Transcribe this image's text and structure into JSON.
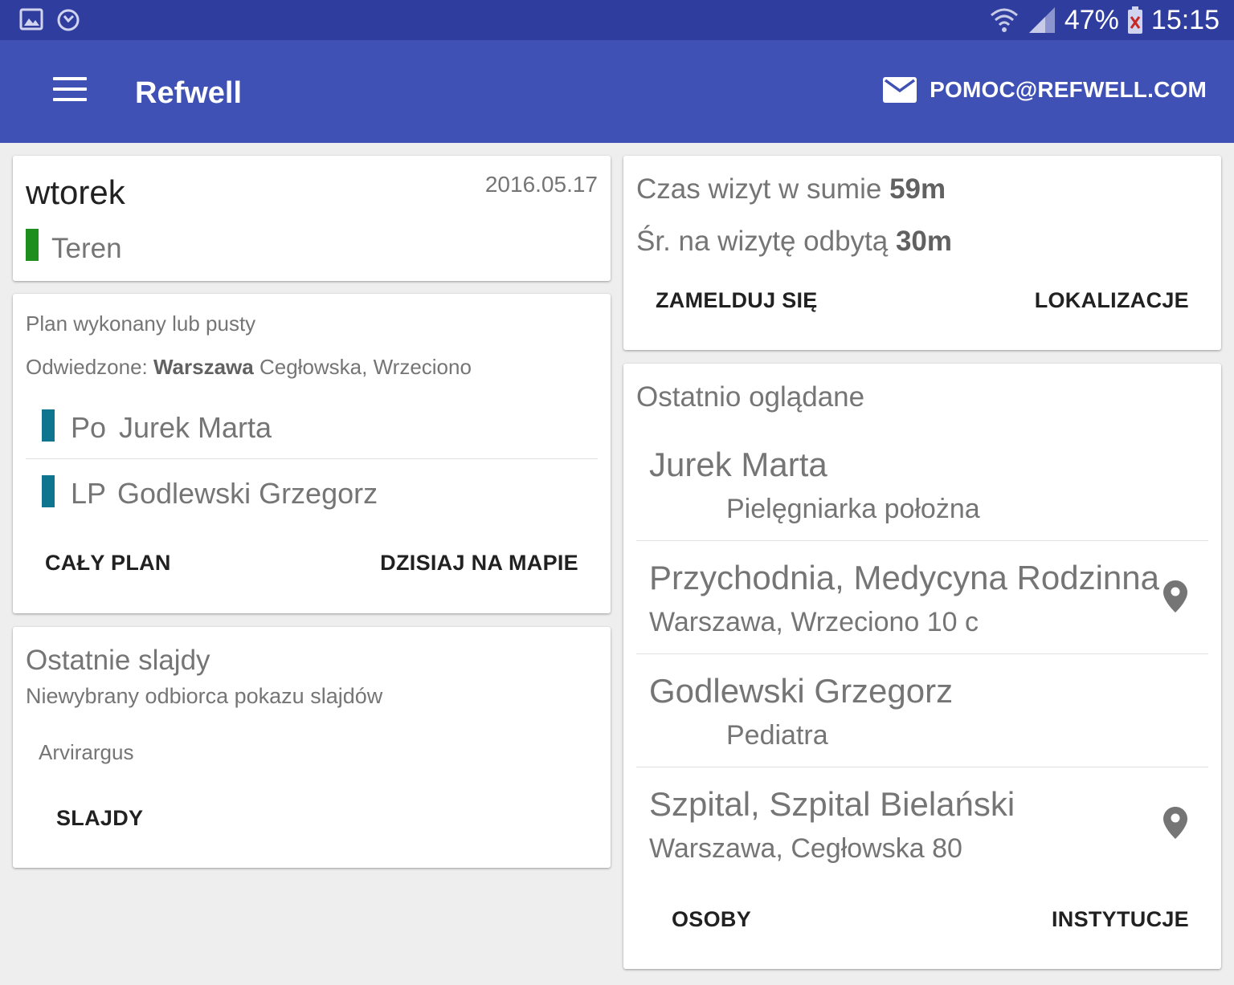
{
  "status_bar": {
    "battery": "47%",
    "time": "15:15",
    "left_icons": [
      "image-icon",
      "clock-icon"
    ],
    "right_icons": [
      "wifi-icon",
      "signal-icon",
      "battery-icon"
    ]
  },
  "app_bar": {
    "title": "Refwell",
    "email": "POMOC@REFWELL.COM"
  },
  "day_card": {
    "day": "wtorek",
    "date": "2016.05.17",
    "type": "Teren",
    "type_color": "#1e8e1e"
  },
  "plan_card": {
    "status": "Plan wykonany lub pusty",
    "visited_prefix": "Odwiedzone: ",
    "visited_city": "Warszawa",
    "visited_rest": " Cegłowska, Wrzeciono",
    "items": [
      {
        "code": "Po",
        "name": "Jurek Marta",
        "color": "#0e7490"
      },
      {
        "code": "LP",
        "name": "Godlewski Grzegorz",
        "color": "#0e7490"
      }
    ],
    "btn_plan": "CAŁY PLAN",
    "btn_map": "DZISIAJ NA MAPIE"
  },
  "slides_card": {
    "title": "Ostatnie slajdy",
    "subtitle": "Niewybrany odbiorca pokazu slajdów",
    "item": "Arvirargus",
    "btn": "SLAJDY"
  },
  "stats_card": {
    "total_label": "Czas wizyt w sumie ",
    "total_value": "59m",
    "avg_label": "Śr. na wizytę odbytą ",
    "avg_value": "30m",
    "btn_checkin": "ZAMELDUJ SIĘ",
    "btn_locations": "LOKALIZACJE"
  },
  "recent_card": {
    "title": "Ostatnio oglądane",
    "items": [
      {
        "title": "Jurek Marta",
        "subtitle": "Pielęgniarka położna",
        "pin": false
      },
      {
        "title": "Przychodnia, Medycyna Rodzinna",
        "subtitle": "Warszawa, Wrzeciono 10 c",
        "pin": true
      },
      {
        "title": "Godlewski Grzegorz",
        "subtitle": "Pediatra",
        "pin": false
      },
      {
        "title": "Szpital, Szpital Bielański",
        "subtitle": "Warszawa, Cegłowska 80",
        "pin": true
      }
    ],
    "btn_people": "OSOBY",
    "btn_institutions": "INSTYTUCJE"
  },
  "colors": {
    "status_bar": "#2f3e9e",
    "app_bar": "#3f51b5",
    "background": "#eeeeee"
  }
}
